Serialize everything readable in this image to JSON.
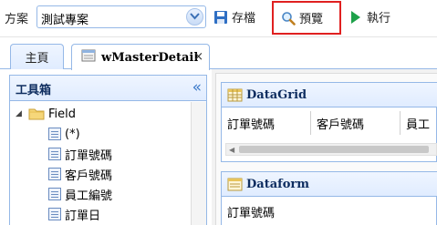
{
  "toolbar": {
    "scheme_label": "方案",
    "scheme_value": "測試專案",
    "save_label": "存檔",
    "preview_label": "預覽",
    "execute_label": "執行"
  },
  "tabs": {
    "home_label": "主頁",
    "active_label": "wMasterDetail",
    "close_glyph": "×"
  },
  "toolbox": {
    "title": "工具箱",
    "collapse_glyph": "«",
    "tree": {
      "root_label": "Field",
      "items": [
        "(*)",
        "訂單號碼",
        "客戶號碼",
        "員工編號",
        "訂單日"
      ]
    }
  },
  "design": {
    "datagrid": {
      "title": "DataGrid",
      "columns": [
        "訂單號碼",
        "客戶號碼",
        "員工"
      ]
    },
    "dataform": {
      "title": "Dataform",
      "fields": [
        "訂單號碼"
      ]
    }
  },
  "colors": {
    "accent_border": "#95b8e7",
    "highlight_red": "#e02020",
    "header_gradient_start": "#eff5ff",
    "header_gradient_end": "#e0ecff"
  },
  "icons": [
    "chevron-down-icon",
    "save-icon",
    "magnifier-icon",
    "play-icon",
    "double-chevron-left-icon",
    "folder-icon",
    "field-item-icon",
    "datagrid-icon",
    "dataform-icon",
    "close-icon"
  ]
}
